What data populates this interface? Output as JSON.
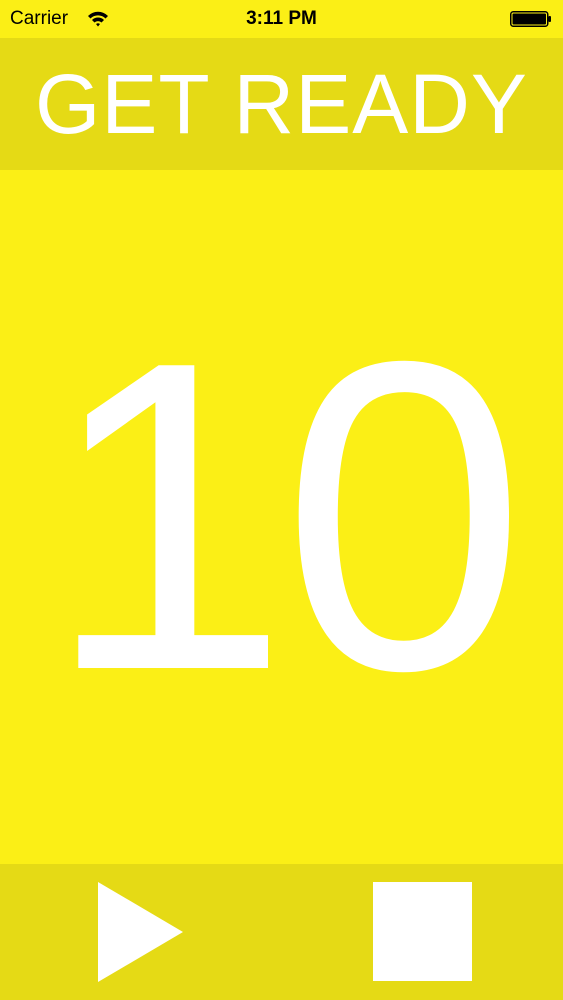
{
  "status_bar": {
    "carrier": "Carrier",
    "time": "3:11 PM",
    "wifi_icon": "wifi-icon",
    "battery_icon": "battery-icon"
  },
  "header": {
    "title": "GET READY"
  },
  "main": {
    "countdown": "10"
  },
  "toolbar": {
    "play_icon": "play-icon",
    "stop_icon": "stop-icon"
  },
  "colors": {
    "background": "#FBEF16",
    "bar_background": "#E5DA15",
    "text": "#FFFFFF"
  }
}
